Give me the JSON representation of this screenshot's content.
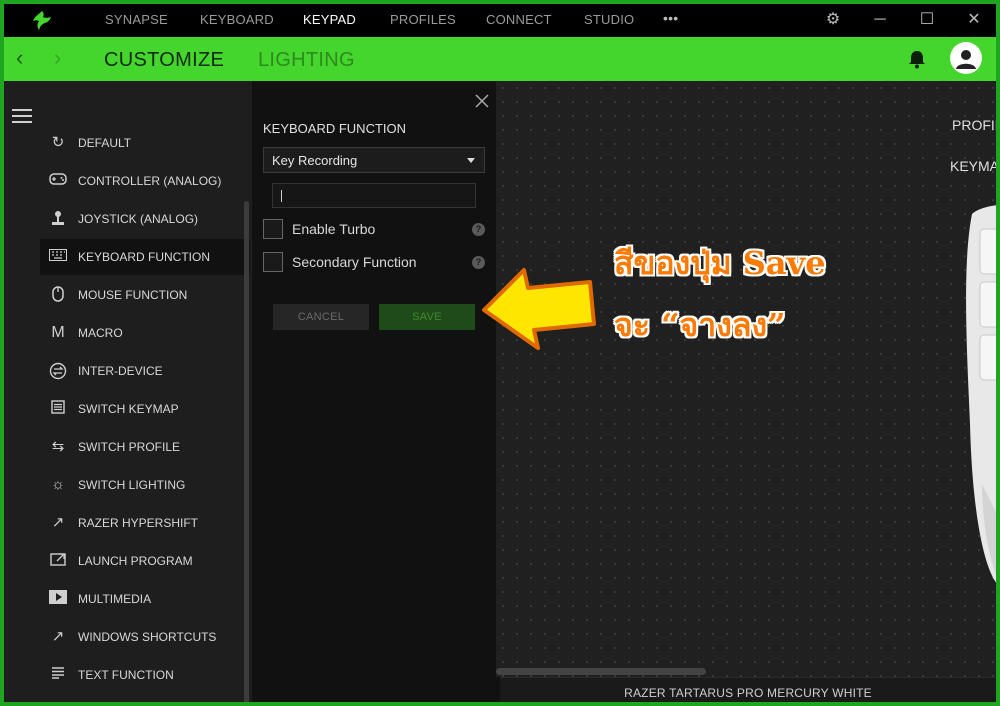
{
  "topnav": {
    "items": [
      "SYNAPSE",
      "KEYBOARD",
      "KEYPAD",
      "PROFILES",
      "CONNECT",
      "STUDIO"
    ],
    "active": "KEYPAD",
    "more": "•••",
    "icons": [
      "settings-icon",
      "minimize-icon",
      "maximize-icon",
      "close-icon"
    ]
  },
  "greenbar": {
    "tabs": [
      "CUSTOMIZE",
      "LIGHTING"
    ],
    "active": "CUSTOMIZE"
  },
  "sidebar": {
    "items": [
      {
        "label": "DEFAULT",
        "icon": "default-icon"
      },
      {
        "label": "CONTROLLER (ANALOG)",
        "icon": "gamepad-icon"
      },
      {
        "label": "JOYSTICK (ANALOG)",
        "icon": "joystick-icon"
      },
      {
        "label": "KEYBOARD FUNCTION",
        "icon": "keyboard-icon"
      },
      {
        "label": "MOUSE FUNCTION",
        "icon": "mouse-icon"
      },
      {
        "label": "MACRO",
        "icon": "macro-icon"
      },
      {
        "label": "INTER-DEVICE",
        "icon": "inter-device-icon"
      },
      {
        "label": "SWITCH KEYMAP",
        "icon": "keymap-icon"
      },
      {
        "label": "SWITCH PROFILE",
        "icon": "switch-profile-icon"
      },
      {
        "label": "SWITCH LIGHTING",
        "icon": "lighting-icon"
      },
      {
        "label": "RAZER HYPERSHIFT",
        "icon": "hypershift-icon"
      },
      {
        "label": "LAUNCH PROGRAM",
        "icon": "launch-icon"
      },
      {
        "label": "MULTIMEDIA",
        "icon": "multimedia-icon"
      },
      {
        "label": "WINDOWS SHORTCUTS",
        "icon": "shortcut-icon"
      },
      {
        "label": "TEXT FUNCTION",
        "icon": "text-icon"
      }
    ],
    "selected": "KEYBOARD FUNCTION"
  },
  "panel": {
    "title": "KEYBOARD FUNCTION",
    "dropdown_value": "Key Recording",
    "input_value": "",
    "checkboxes": [
      {
        "label": "Enable Turbo",
        "checked": false
      },
      {
        "label": "Secondary Function",
        "checked": false
      }
    ],
    "help": "?",
    "cancel_label": "CANCEL",
    "save_label": "SAVE"
  },
  "main": {
    "right_labels": [
      "PROFIL",
      "KEYMA"
    ],
    "device_name": "RAZER TARTARUS PRO MERCURY WHITE"
  },
  "annotation": {
    "line1": "สีของปุ่ม Save",
    "line2": "จะ “จางลง”",
    "color": "#ff7a00"
  },
  "colors": {
    "accent": "#44d62c",
    "frame": "#1fa51f"
  }
}
